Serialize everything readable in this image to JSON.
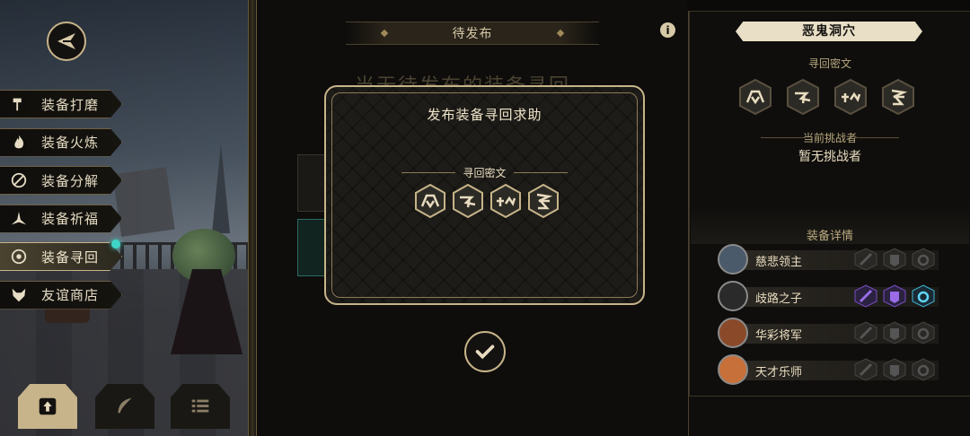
{
  "left_menu": {
    "items": [
      {
        "label": "装备打磨",
        "icon": "hammer-icon"
      },
      {
        "label": "装备火炼",
        "icon": "fire-icon"
      },
      {
        "label": "装备分解",
        "icon": "split-icon"
      },
      {
        "label": "装备祈福",
        "icon": "blessing-icon"
      },
      {
        "label": "装备寻回",
        "icon": "target-icon"
      },
      {
        "label": "友谊商店",
        "icon": "fox-icon"
      }
    ],
    "active_index": 4
  },
  "center": {
    "pending_tab": "待发布",
    "background_heading": "当无待发布的装备寻回"
  },
  "modal": {
    "title": "发布装备寻回求助",
    "cipher_label": "寻回密文",
    "glyphs": [
      "rune-1-icon",
      "rune-2-icon",
      "rune-3-icon",
      "rune-4-icon"
    ]
  },
  "right_panel": {
    "location": "恶鬼洞穴",
    "cipher_label": "寻回密文",
    "challenger_label": "当前挑战者",
    "challenger_value": "暂无挑战者",
    "equipment_label": "装备详情",
    "equipment": [
      {
        "name": "慈悲领主",
        "avatar_color": "#4a5a6a",
        "slots_active": false
      },
      {
        "name": "歧路之子",
        "avatar_color": "#2a2a2a",
        "slots_active": true
      },
      {
        "name": "华彩将军",
        "avatar_color": "#8a4a2a",
        "slots_active": false
      },
      {
        "name": "天才乐师",
        "avatar_color": "#c8703a",
        "slots_active": false
      }
    ]
  },
  "colors": {
    "gold": "#c7b48a",
    "active_slot_purple": "#7a4cc8",
    "active_slot_teal": "#3fb6d6",
    "notification_dot": "#3fd6c7"
  }
}
